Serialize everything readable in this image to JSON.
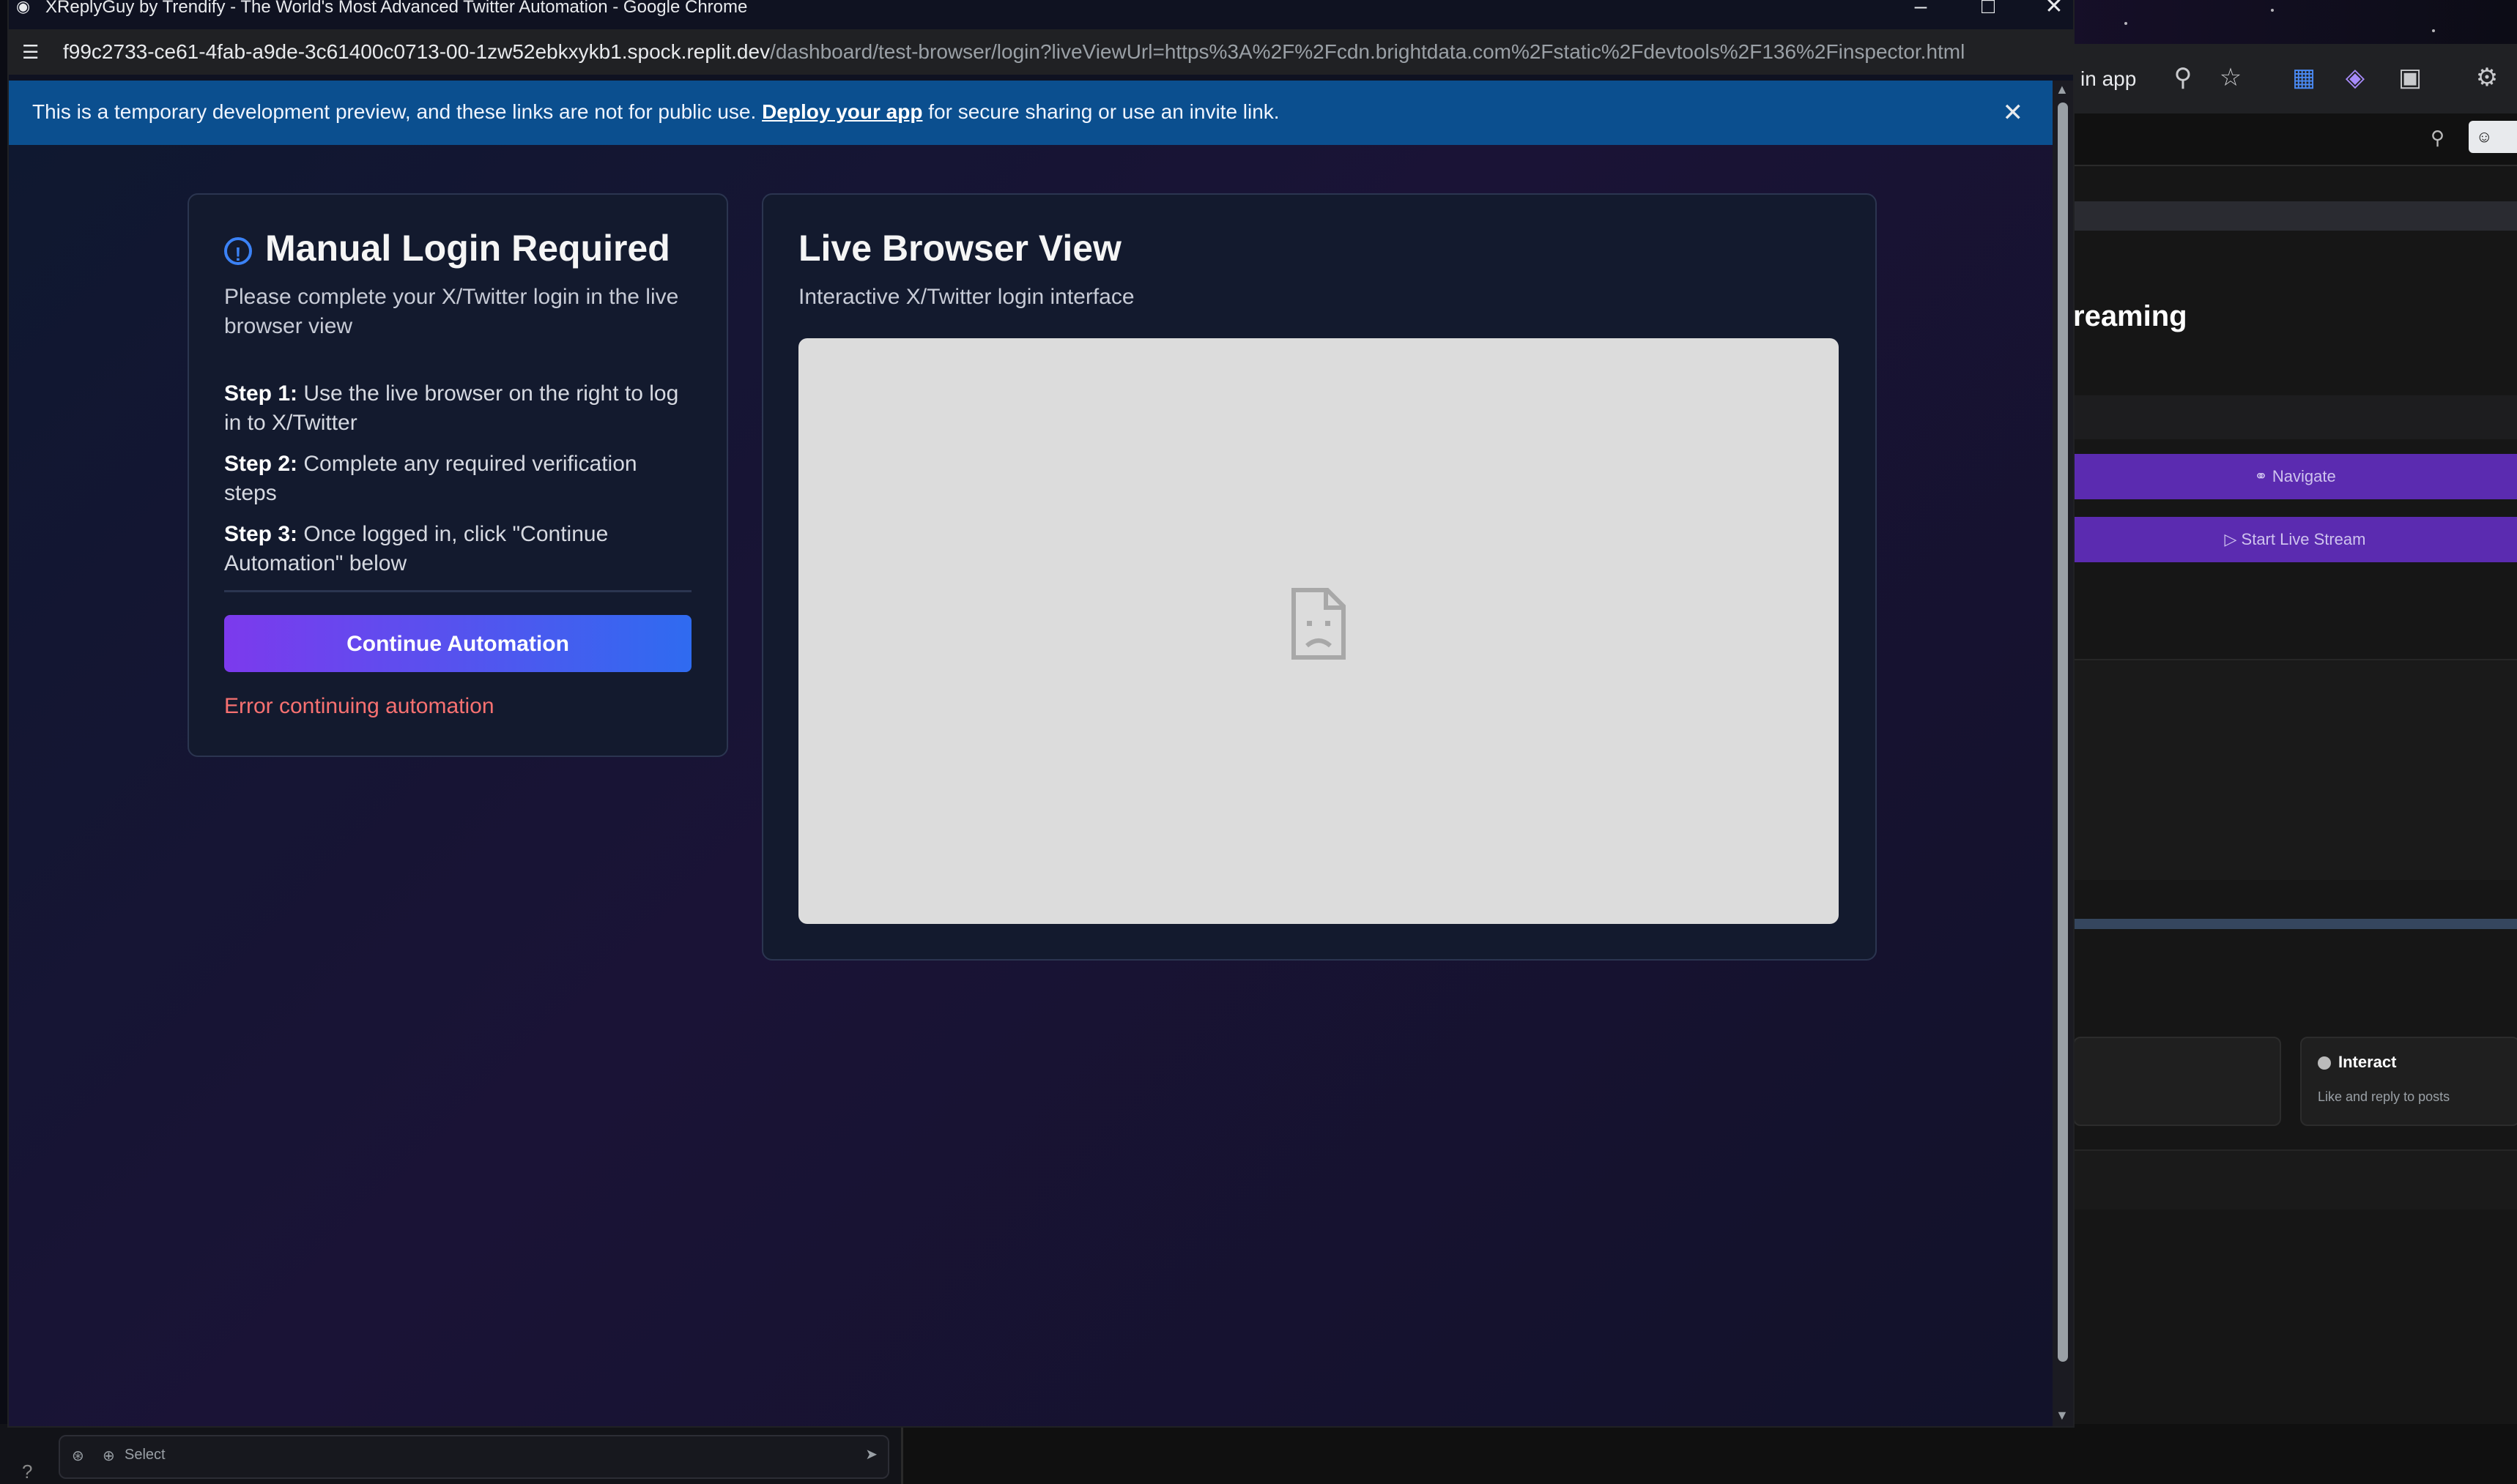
{
  "window": {
    "title": "XReplyGuy by Trendify - The World's Most Advanced Twitter Automation - Google Chrome",
    "url_host": "f99c2733-ce61-4fab-a9de-3c61400c0713-00-1zw52ebkxykb1.spock.replit.dev",
    "url_path": "/dashboard/test-browser/login?liveViewUrl=https%3A%2F%2Fcdn.brightdata.com%2Fstatic%2Fdevtools%2F136%2Finspector.html"
  },
  "banner": {
    "text_before": "This is a temporary development preview, and these links are not for public use. ",
    "link": "Deploy your app",
    "text_after": " for secure sharing or use an invite link."
  },
  "login_card": {
    "title": "Manual Login Required",
    "subtitle": "Please complete your X/Twitter login in the live browser view",
    "steps": [
      {
        "label": "Step 1:",
        "text": " Use the live browser on the right to log in to X/Twitter"
      },
      {
        "label": "Step 2:",
        "text": " Complete any required verification steps"
      },
      {
        "label": "Step 3:",
        "text": " Once logged in, click \"Continue Automation\" below"
      }
    ],
    "button": "Continue Automation",
    "error": "Error continuing automation"
  },
  "live_view": {
    "title": "Live Browser View",
    "subtitle": "Interactive X/Twitter login interface"
  },
  "background_app": {
    "open_in_app": "in app",
    "heading_fragment": "reaming",
    "navigate_button": "Navigate",
    "start_stream_button": "Start Live Stream",
    "interact_title": "Interact",
    "interact_desc": "Like and reply to posts",
    "select_label": "Select",
    "help": "?"
  },
  "colors": {
    "accent_purple": "#7c3aed",
    "accent_blue": "#2f6bf0",
    "banner_blue": "#0b4f8f",
    "error_red": "#f87171"
  }
}
